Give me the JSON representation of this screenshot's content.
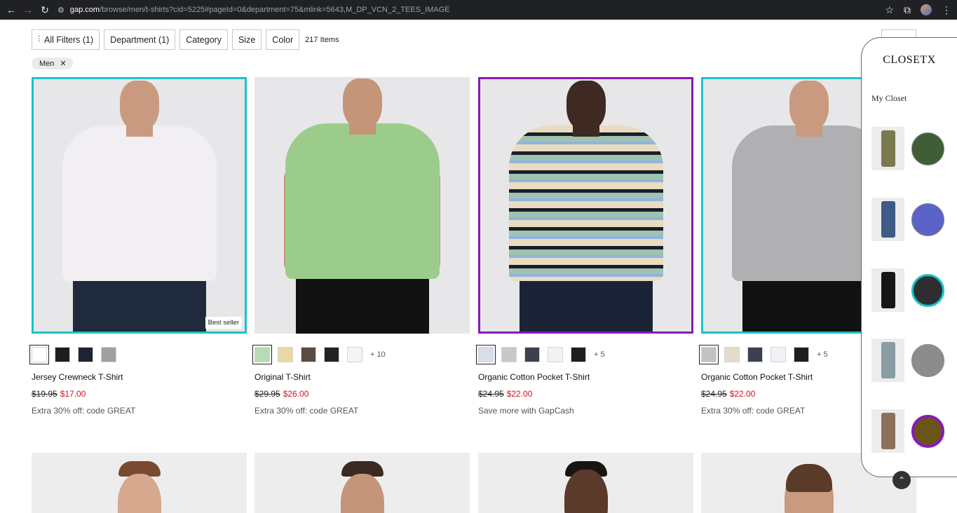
{
  "browser": {
    "url_domain": "gap.com",
    "url_path": "/browse/men/t-shirts?cid=5225#pageId=0&department=75&mlink=5643,M_DP_VCN_2_TEES_IMAGE"
  },
  "filters": {
    "all_filters": "All Filters (1)",
    "department": "Department (1)",
    "category": "Category",
    "size": "Size",
    "color": "Color",
    "item_count": "217 Items"
  },
  "applied_chip": {
    "label": "Men"
  },
  "products": [
    {
      "name": "Jersey Crewneck T-Shirt",
      "orig_price": "$19.95",
      "sale_price": "$17.00",
      "promo": "Extra 30% off: code GREAT",
      "badge": "Best seller",
      "shirt_color": "#f1eff2",
      "pants_color": "#1f2a3d",
      "skin": "#c99a80",
      "swatches": [
        "#ffffff",
        "#1e1e1e",
        "#1f2335",
        "#a0a0a0"
      ],
      "more_colors": ""
    },
    {
      "name": "Original T-Shirt",
      "orig_price": "$29.95",
      "sale_price": "$26.00",
      "promo": "Extra 30% off: code GREAT",
      "badge": "",
      "shirt_color": "#9ccc8c",
      "pants_color": "#111111",
      "skin": "#c49579",
      "swatches": [
        "#b6dcb3",
        "#ead9a4",
        "#5a4b43",
        "#222222",
        "#f4f4f8"
      ],
      "more_colors": "+ 10"
    },
    {
      "name": "Organic Cotton Pocket T-Shirt",
      "orig_price": "$24.95",
      "sale_price": "$22.00",
      "promo": "Save more with GapCash",
      "badge": "",
      "shirt_color": "#e9dcc0",
      "pants_color": "#1b2436",
      "skin": "#3e2a22",
      "swatches": [
        "#d8dde8",
        "#c8c8ca",
        "#3c4050",
        "#f1f1f6",
        "#1e1e1e"
      ],
      "more_colors": "+ 5"
    },
    {
      "name": "Organic Cotton Pocket T-Shirt",
      "orig_price": "$24.95",
      "sale_price": "$22.00",
      "promo": "Extra 30% off: code GREAT",
      "badge": "",
      "shirt_color": "#b0b0b2",
      "pants_color": "#111111",
      "skin": "#c99a80",
      "swatches": [
        "#c2c2c4",
        "#e3dcc8",
        "#3c4050",
        "#f1f1f6",
        "#1e1e1e"
      ],
      "more_colors": "+ 5"
    }
  ],
  "closet": {
    "title": "CLOSETX",
    "subtitle": "My Closet",
    "items": [
      {
        "pant_color": "#7b7a4e",
        "dot_color": "#3f5e36"
      },
      {
        "pant_color": "#3e5a86",
        "dot_color": "#5b62c8"
      },
      {
        "pant_color": "#161616",
        "dot_color": "#2e2e30"
      },
      {
        "pant_color": "#8a9da4",
        "dot_color": "#8c8c8e"
      },
      {
        "pant_color": "#8a7158",
        "dot_color": "#6a5418"
      }
    ]
  },
  "colors": {
    "accent_teal": "#17c3c9",
    "accent_purple": "#8b18b8",
    "sale_red": "#d1101d"
  },
  "icons": {
    "back": "←",
    "forward": "→",
    "reload": "↻",
    "site_info": "⚙",
    "star": "☆",
    "extension": "⧉",
    "menu": "⋮",
    "filter": "⫶",
    "close": "✕",
    "scroll_up": "⌃"
  }
}
